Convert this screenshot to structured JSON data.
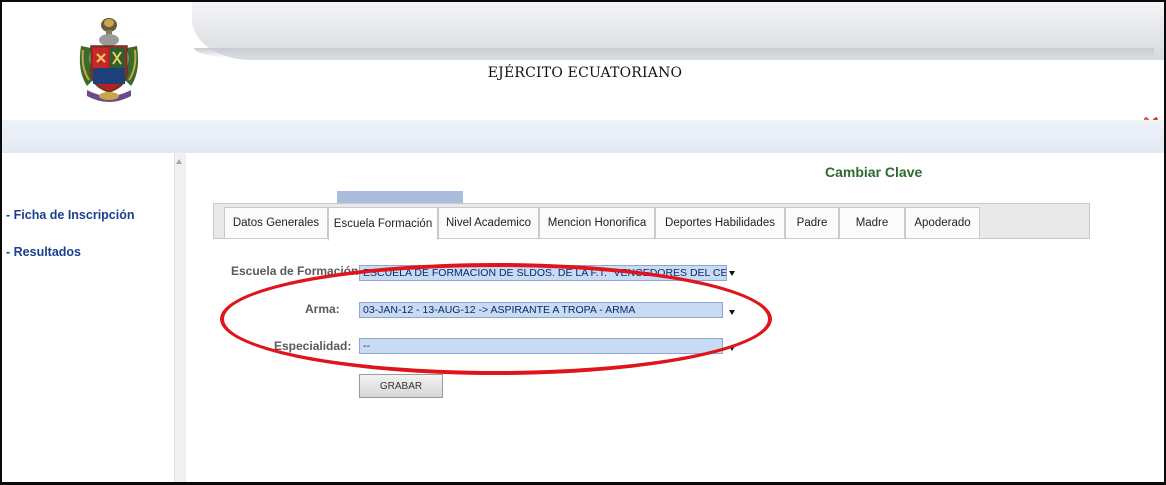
{
  "header": {
    "title": "EJÉRCITO ECUATORIANO",
    "logo_icon": "army-coat-of-arms-icon",
    "close_icon": "close-icon"
  },
  "sidebar": {
    "items": [
      {
        "label": "- Ficha de Inscripción"
      },
      {
        "label": "- Resultados"
      }
    ]
  },
  "main": {
    "change_password": "Cambiar Clave",
    "tabs": [
      {
        "label": "Datos Generales"
      },
      {
        "label": "Escuela Formación",
        "active": true
      },
      {
        "label": "Nivel Academico"
      },
      {
        "label": "Mencion Honorifica"
      },
      {
        "label": "Deportes Habilidades"
      },
      {
        "label": "Padre"
      },
      {
        "label": "Madre"
      },
      {
        "label": "Apoderado"
      }
    ],
    "form": {
      "school_label": "Escuela de Formación:",
      "school_value": "ESCUELA DE FORMACION DE SLDOS. DE LA F.T. \"VENCEDORES DEL CENE",
      "arma_label": "Arma:",
      "arma_value": "03-JAN-12 - 13-AUG-12 -> ASPIRANTE A TROPA - ARMA",
      "specialty_label": "Especialidad:",
      "specialty_value": "--",
      "save_label": "GRABAR"
    }
  },
  "colors": {
    "link": "#1b3f8f",
    "change_password": "#2e6a2b",
    "highlight_ellipse": "#e0141b",
    "select_bg": "#c9daf5"
  }
}
